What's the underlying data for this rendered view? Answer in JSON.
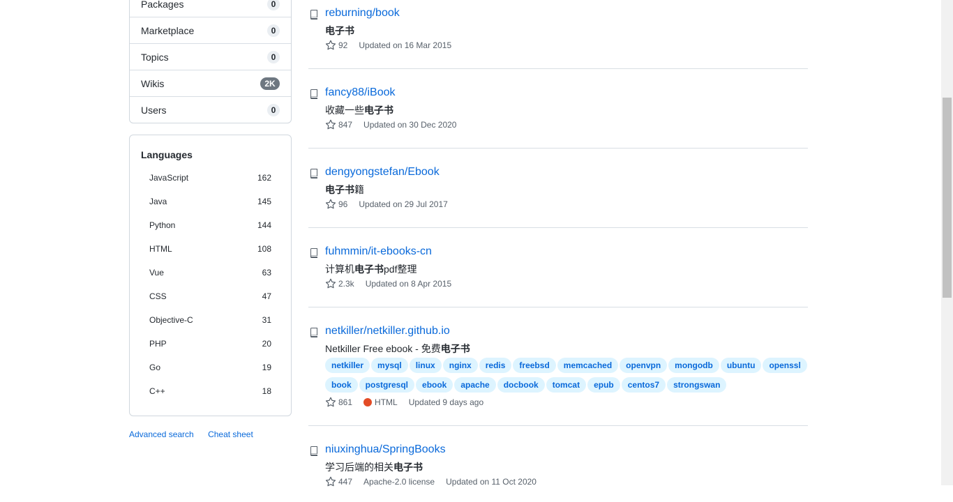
{
  "sidebar": {
    "menu": [
      {
        "label": "Packages",
        "count": "0"
      },
      {
        "label": "Marketplace",
        "count": "0"
      },
      {
        "label": "Topics",
        "count": "0"
      },
      {
        "label": "Wikis",
        "count": "2K"
      },
      {
        "label": "Users",
        "count": "0"
      }
    ],
    "languages_title": "Languages",
    "languages": [
      {
        "name": "JavaScript",
        "count": "162"
      },
      {
        "name": "Java",
        "count": "145"
      },
      {
        "name": "Python",
        "count": "144"
      },
      {
        "name": "HTML",
        "count": "108"
      },
      {
        "name": "Vue",
        "count": "63"
      },
      {
        "name": "CSS",
        "count": "47"
      },
      {
        "name": "Objective-C",
        "count": "31"
      },
      {
        "name": "PHP",
        "count": "20"
      },
      {
        "name": "Go",
        "count": "19"
      },
      {
        "name": "C++",
        "count": "18"
      }
    ],
    "advanced_search": "Advanced search",
    "cheat_sheet": "Cheat sheet"
  },
  "results": [
    {
      "title": "reburning/book",
      "desc_pre": "",
      "desc_em": "电子书",
      "desc_post": "",
      "stars": "92",
      "updated": "Updated on 16 Mar 2015"
    },
    {
      "title": "fancy88/iBook",
      "desc_pre": "收藏一些",
      "desc_em": "电子书",
      "desc_post": "",
      "stars": "847",
      "updated": "Updated on 30 Dec 2020"
    },
    {
      "title": "dengyongstefan/Ebook",
      "desc_pre": "",
      "desc_em": "电子书",
      "desc_post": "籍",
      "stars": "96",
      "updated": "Updated on 29 Jul 2017"
    },
    {
      "title": "fuhmmin/it-ebooks-cn",
      "desc_pre": "计算机",
      "desc_em": "电子书",
      "desc_post": "pdf整理",
      "stars": "2.3k",
      "updated": "Updated on 8 Apr 2015"
    },
    {
      "title": "netkiller/netkiller.github.io",
      "desc_pre": "Netkiller Free ebook - 免费",
      "desc_em": "电子书",
      "desc_post": "",
      "stars": "861",
      "language": "HTML",
      "language_color": "#e34c26",
      "updated": "Updated 9 days ago",
      "topics": [
        "netkiller",
        "mysql",
        "linux",
        "nginx",
        "redis",
        "freebsd",
        "memcached",
        "openvpn",
        "mongodb",
        "ubuntu",
        "openssl",
        "book",
        "postgresql",
        "ebook",
        "apache",
        "docbook",
        "tomcat",
        "epub",
        "centos7",
        "strongswan"
      ]
    },
    {
      "title": "niuxinghua/SpringBooks",
      "desc_pre": "学习后端的相关",
      "desc_em": "电子书",
      "desc_post": "",
      "stars": "447",
      "license": "Apache-2.0 license",
      "updated": "Updated on 11 Oct 2020"
    }
  ],
  "icons": {
    "repo": "repo-icon",
    "star": "star-icon"
  },
  "colors": {
    "link": "#0969da",
    "topic_bg": "#ddf4ff"
  }
}
